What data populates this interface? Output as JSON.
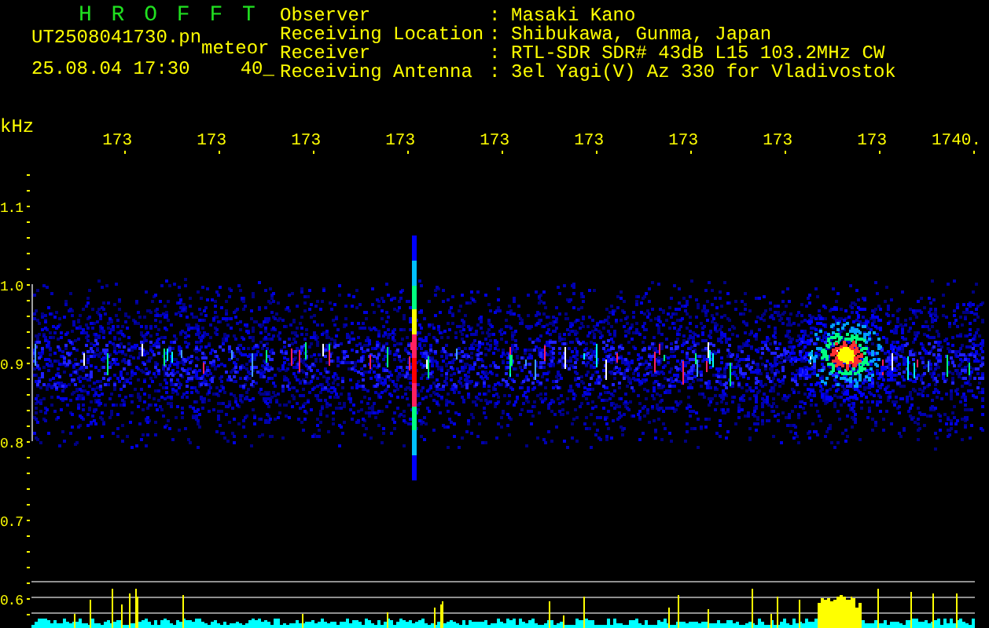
{
  "header": {
    "title": "H R O F F T",
    "file": "UT2508041730.pn",
    "mode": "meteor",
    "datetime": "25.08.04 17:30",
    "count": "40_"
  },
  "info": [
    {
      "label": "Observer",
      "colon": ":",
      "value": "Masaki Kano"
    },
    {
      "label": "Receiving Location",
      "colon": ":",
      "value": "Shibukawa, Gunma, Japan"
    },
    {
      "label": "Receiver",
      "colon": ":",
      "value": "RTL-SDR SDR# 43dB L15 103.2MHz CW"
    },
    {
      "label": "Receiving Antenna",
      "colon": ":",
      "value": "3el Yagi(V) Az 330 for Vladivostok"
    }
  ],
  "plot": {
    "unit": "kHz",
    "x_labels": [
      "173",
      "173",
      "173",
      "173",
      "173",
      "173",
      "173",
      "173",
      "173",
      "1740."
    ],
    "y_labels": [
      "1.1",
      "1.0",
      "0.9",
      "0.8",
      "0.7",
      "0.6"
    ]
  }
}
